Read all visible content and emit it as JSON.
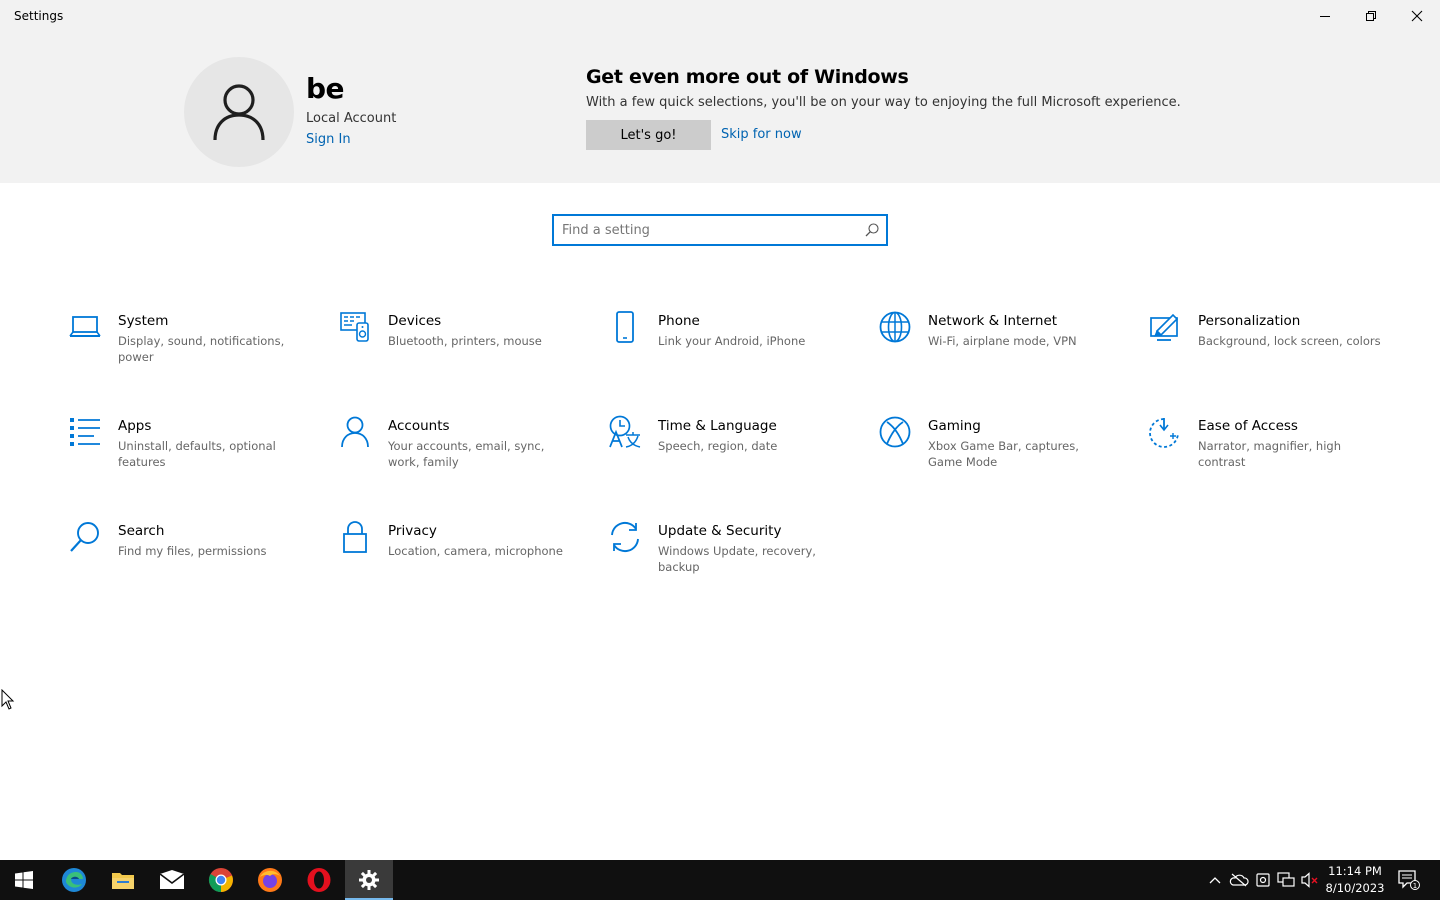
{
  "window": {
    "title": "Settings"
  },
  "account": {
    "name": "be",
    "type": "Local Account",
    "signin_label": "Sign In"
  },
  "promo": {
    "title": "Get even more out of Windows",
    "text": "With a few quick selections, you'll be on your way to enjoying the full Microsoft experience.",
    "primary_label": "Let's go!",
    "skip_label": "Skip for now"
  },
  "search": {
    "placeholder": "Find a setting"
  },
  "categories": [
    {
      "name": "System",
      "desc": "Display, sound, notifications, power",
      "icon": "laptop-icon"
    },
    {
      "name": "Devices",
      "desc": "Bluetooth, printers, mouse",
      "icon": "devices-icon"
    },
    {
      "name": "Phone",
      "desc": "Link your Android, iPhone",
      "icon": "phone-icon"
    },
    {
      "name": "Network & Internet",
      "desc": "Wi-Fi, airplane mode, VPN",
      "icon": "globe-icon"
    },
    {
      "name": "Personalization",
      "desc": "Background, lock screen, colors",
      "icon": "paint-icon"
    },
    {
      "name": "Apps",
      "desc": "Uninstall, defaults, optional features",
      "icon": "apps-list-icon"
    },
    {
      "name": "Accounts",
      "desc": "Your accounts, email, sync, work, family",
      "icon": "person-icon"
    },
    {
      "name": "Time & Language",
      "desc": "Speech, region, date",
      "icon": "time-language-icon"
    },
    {
      "name": "Gaming",
      "desc": "Xbox Game Bar, captures, Game Mode",
      "icon": "xbox-icon"
    },
    {
      "name": "Ease of Access",
      "desc": "Narrator, magnifier, high contrast",
      "icon": "ease-of-access-icon"
    },
    {
      "name": "Search",
      "desc": "Find my files, permissions",
      "icon": "search-icon"
    },
    {
      "name": "Privacy",
      "desc": "Location, camera, microphone",
      "icon": "lock-icon"
    },
    {
      "name": "Update & Security",
      "desc": "Windows Update, recovery, backup",
      "icon": "sync-icon"
    }
  ],
  "taskbar": {
    "apps": [
      "windows-start-icon",
      "edge-icon",
      "file-explorer-icon",
      "mail-icon",
      "chrome-icon",
      "firefox-icon",
      "opera-icon",
      "settings-gear-icon"
    ],
    "time": "11:14 PM",
    "date": "8/10/2023",
    "notification_count": "1"
  },
  "colors": {
    "accent": "#0078d7",
    "link": "#0063b1",
    "header_bg": "#f2f2f2",
    "taskbar_bg": "#101010"
  }
}
